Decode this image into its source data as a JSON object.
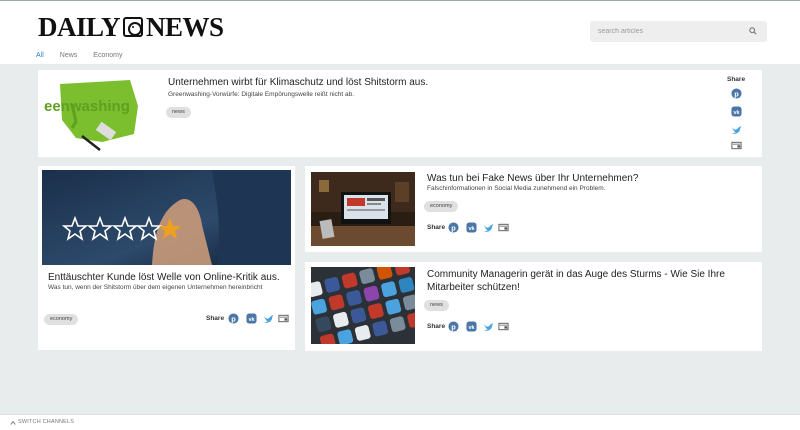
{
  "header": {
    "logo_left": "DAILY",
    "logo_right": "NEWS",
    "search_placeholder": "search articles"
  },
  "tabs": [
    {
      "label": "All",
      "active": true
    },
    {
      "label": "News",
      "active": false
    },
    {
      "label": "Economy",
      "active": false
    }
  ],
  "share_label": "Share",
  "articles": [
    {
      "title": "Unternehmen wirbt für Klimaschutz und löst Shitstorm aus.",
      "subtitle": "Greenwashing-Vorwürfe: Digitale Empörungswelle reißt nicht ab.",
      "tag": "news",
      "image_text": "eenwashing"
    },
    {
      "title": "Enttäuschter Kunde löst Welle von Online-Kritik aus.",
      "subtitle": "Was tun, wenn der Shitstorm über dem eigenen Unternehmen hereinbricht",
      "tag": "economy"
    },
    {
      "title": "Was tun bei Fake News über Ihr Unternehmen?",
      "subtitle": "Falschinformationen in Social Media zunehmend ein Problem.",
      "tag": "economy"
    },
    {
      "title": "Community Managerin gerät in das Auge des Sturms - Wie Sie Ihre Mitarbeiter schützen!",
      "tag": "news"
    }
  ],
  "footer": {
    "switch_label": "SWITCH CHANNELS"
  },
  "colors": {
    "accent": "#2d86c8",
    "icon_blue": "#4a76a8",
    "twitter_blue": "#4aa3df",
    "green": "#7bbf2e"
  }
}
